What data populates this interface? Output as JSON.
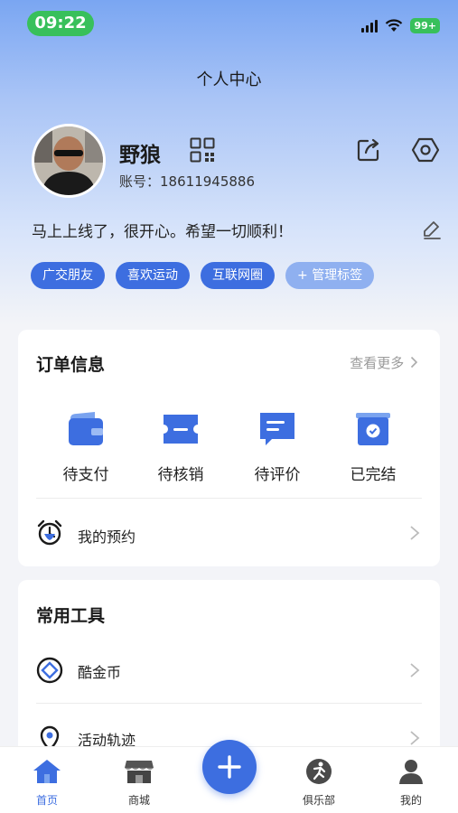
{
  "status_bar": {
    "time": "09:22",
    "battery": "99+"
  },
  "header": {
    "title": "个人中心"
  },
  "profile": {
    "username": "野狼",
    "account_label": "账号：",
    "account": "18611945886",
    "signature": "马上上线了，很开心。希望一切顺利！",
    "tags": [
      "广交朋友",
      "喜欢运动",
      "互联网圈"
    ],
    "manage_tags": "管理标签"
  },
  "orders": {
    "title": "订单信息",
    "more": "查看更多",
    "items": [
      "待支付",
      "待核销",
      "待评价",
      "已完结"
    ],
    "reservation": "我的预约"
  },
  "tools": {
    "title": "常用工具",
    "items": [
      "酷金币",
      "活动轨迹"
    ]
  },
  "tabbar": {
    "items": [
      "首页",
      "商城",
      "俱乐部",
      "我的"
    ]
  },
  "colors": {
    "primary": "#3d6ee0",
    "status_green": "#38c05b"
  }
}
